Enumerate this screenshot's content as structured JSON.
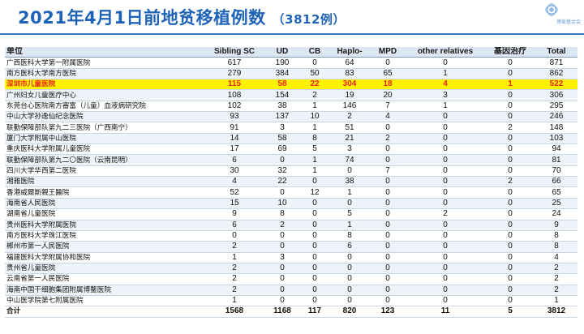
{
  "title": {
    "main": "2021年4月1日前地贫移植例数",
    "sub": "（3812例）"
  },
  "logo": {
    "text": "博爱基金会",
    "icon": "flower-logo-icon",
    "color": "#6a9ed0"
  },
  "colors": {
    "title": "#1e63b8",
    "highlight_bg": "#fff200",
    "highlight_text": "#e8271b"
  },
  "table": {
    "headers": [
      "单位",
      "Sibling SC",
      "UD",
      "CB",
      "Haplo-",
      "MPD",
      "other relatives",
      "基因治疗",
      "Total"
    ],
    "rows": [
      {
        "name": "广西医科大学第一附属医院",
        "values": [
          "617",
          "190",
          "0",
          "64",
          "0",
          "0",
          "0",
          "871"
        ]
      },
      {
        "name": "南方医科大学南方医院",
        "values": [
          "279",
          "384",
          "50",
          "83",
          "65",
          "1",
          "0",
          "862"
        ]
      },
      {
        "name": "深圳市儿童医院",
        "values": [
          "115",
          "58",
          "22",
          "304",
          "18",
          "4",
          "1",
          "522"
        ],
        "highlight": true
      },
      {
        "name": "广州妇女儿童医疗中心",
        "values": [
          "108",
          "154",
          "2",
          "19",
          "20",
          "3",
          "0",
          "306"
        ]
      },
      {
        "name": "东莞台心医院南方審富（儿童）血液病研究院",
        "values": [
          "102",
          "38",
          "1",
          "146",
          "7",
          "1",
          "0",
          "295"
        ]
      },
      {
        "name": "中山大学孙逸仙纪念医院",
        "values": [
          "93",
          "137",
          "10",
          "2",
          "4",
          "0",
          "0",
          "246"
        ]
      },
      {
        "name": "联勤保障部队第九二三医院（广西南宁）",
        "values": [
          "91",
          "3",
          "1",
          "51",
          "0",
          "0",
          "2",
          "148"
        ]
      },
      {
        "name": "厦门大学附属中山医院",
        "values": [
          "14",
          "58",
          "8",
          "21",
          "2",
          "0",
          "0",
          "103"
        ]
      },
      {
        "name": "重庆医科大学附属儿童医院",
        "values": [
          "17",
          "69",
          "5",
          "3",
          "0",
          "0",
          "0",
          "94"
        ]
      },
      {
        "name": "联勤保障部队第九二〇医院（云南昆明）",
        "values": [
          "6",
          "0",
          "1",
          "74",
          "0",
          "0",
          "0",
          "81"
        ]
      },
      {
        "name": "四川大学华西第二医院",
        "values": [
          "30",
          "32",
          "1",
          "0",
          "7",
          "0",
          "0",
          "70"
        ]
      },
      {
        "name": "湘雅医院",
        "values": [
          "4",
          "22",
          "0",
          "38",
          "0",
          "0",
          "2",
          "66"
        ]
      },
      {
        "name": "香港威爾斯親王醫院",
        "values": [
          "52",
          "0",
          "12",
          "1",
          "0",
          "0",
          "0",
          "65"
        ]
      },
      {
        "name": "海南省人民医院",
        "values": [
          "15",
          "10",
          "0",
          "0",
          "0",
          "0",
          "0",
          "25"
        ]
      },
      {
        "name": "湖南省儿童医院",
        "values": [
          "9",
          "8",
          "0",
          "5",
          "0",
          "2",
          "0",
          "24"
        ]
      },
      {
        "name": "贵州医科大学附属医院",
        "values": [
          "6",
          "2",
          "0",
          "1",
          "0",
          "0",
          "0",
          "9"
        ]
      },
      {
        "name": "南方医科大学珠江医院",
        "values": [
          "0",
          "0",
          "0",
          "8",
          "0",
          "0",
          "0",
          "8"
        ]
      },
      {
        "name": "郴州市第一人民医院",
        "values": [
          "2",
          "0",
          "0",
          "6",
          "0",
          "0",
          "0",
          "8"
        ]
      },
      {
        "name": "福建医科大学附属协和医院",
        "values": [
          "1",
          "3",
          "0",
          "0",
          "0",
          "0",
          "0",
          "4"
        ]
      },
      {
        "name": "贵州省儿童医院",
        "values": [
          "2",
          "0",
          "0",
          "0",
          "0",
          "0",
          "0",
          "2"
        ]
      },
      {
        "name": "云南省第一人民医院",
        "values": [
          "2",
          "0",
          "0",
          "0",
          "0",
          "0",
          "0",
          "2"
        ]
      },
      {
        "name": "海南中国干细胞集团附属博鳌医院",
        "values": [
          "2",
          "0",
          "0",
          "0",
          "0",
          "0",
          "0",
          "2"
        ]
      },
      {
        "name": "中山医学院第七附属医院",
        "values": [
          "1",
          "0",
          "0",
          "0",
          "0",
          "0",
          "0",
          "1"
        ]
      }
    ],
    "total": {
      "name": "合计",
      "values": [
        "1568",
        "1168",
        "117",
        "820",
        "123",
        "11",
        "5",
        "3812"
      ]
    }
  }
}
